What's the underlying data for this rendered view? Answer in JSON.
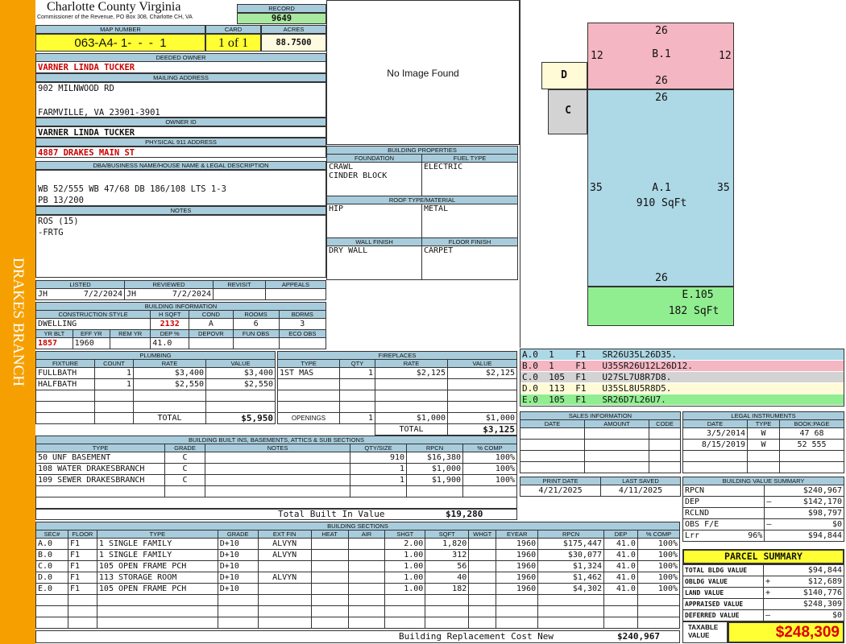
{
  "side_label": "DRAKES BRANCH",
  "header": {
    "county": "Charlotte County Virginia",
    "commissioner": "Commissioner of the Revenue, PO Box 308, Charlotte CH, VA",
    "record_label": "RECORD",
    "record": "9649",
    "map_label": "MAP NUMBER",
    "map_number": "063-A4- 1-  -  -  1",
    "card_label": "CARD",
    "card": "1 of 1",
    "acres_label": "ACRES",
    "acres": "88.7500"
  },
  "owner": {
    "deeded_label": "DEEDED OWNER",
    "deeded": "VARNER LINDA TUCKER",
    "mailing_label": "MAILING ADDRESS",
    "mail1": "902 MILNWOOD RD",
    "mail2": "FARMVILLE, VA 23901-3901",
    "owner_id_label": "OWNER ID",
    "owner_id": "VARNER LINDA TUCKER",
    "phys_label": "PHYSICAL 911 ADDRESS",
    "phys": "4887 DRAKES MAIN ST"
  },
  "legal": {
    "label": "DBA/BUSINESS NAME/HOUSE NAME & LEGAL DESCRIPTION",
    "line1": "WB 52/555 WB 47/68 DB 186/108 LTS 1-3",
    "line2": "PB 13/200"
  },
  "notes": {
    "label": "NOTES",
    "line1": "ROS (15)",
    "line2": "-FRTG"
  },
  "review": {
    "listed_label": "LISTED",
    "reviewed_label": "REVIEWED",
    "revisit_label": "REVISIT",
    "appeals_label": "APPEALS",
    "listed_by": "JH",
    "listed_date": "7/2/2024",
    "reviewed_by": "JH",
    "reviewed_date": "7/2/2024"
  },
  "bldg_info": {
    "label": "BUILDING INFORMATION",
    "cs_label": "CONSTRUCTION STYLE",
    "hsqft_label": "H SQFT",
    "cond_label": "COND",
    "rooms_label": "ROOMS",
    "bdrms_label": "BDRMS",
    "style": "DWELLING",
    "hsqft": "2132",
    "cond": "A",
    "rooms": "6",
    "bdrms": "3",
    "yrblt_label": "YR BLT",
    "effyr_label": "EFF YR",
    "remyr_label": "REM YR",
    "dep_label": "DEP %",
    "depovr_label": "DEPOVR",
    "funobs_label": "FUN OBS",
    "ecoobs_label": "ECO OBS",
    "yrblt": "1857",
    "effyr": "1960",
    "dep": "41.0"
  },
  "image": {
    "text": "No Image Found"
  },
  "bprops": {
    "label": "BUILDING PROPERTIES",
    "foundation_label": "FOUNDATION",
    "fuel_label": "FUEL TYPE",
    "foundation1": "CRAWL",
    "foundation2": "CINDER BLOCK",
    "fuel": "ELECTRIC",
    "roof_label": "ROOF TYPE/MATERIAL",
    "roof_type": "HIP",
    "roof_mat": "METAL",
    "wall_label": "WALL FINISH",
    "floor_label": "FLOOR FINISH",
    "wall": "DRY WALL",
    "floor": "CARPET"
  },
  "sketch": {
    "b_top": "26",
    "b_left": "12",
    "b_right": "12",
    "b_name": "B.1",
    "b_bottom": "26",
    "d_name": "D",
    "c_name": "C",
    "a_top": "26",
    "a_left": "35",
    "a_right": "35",
    "a_name": "A.1",
    "a_area": "910 SqFt",
    "a_bottom": "26",
    "e_name": "E.105",
    "e_area": "182 SqFt",
    "colors": {
      "a": "#add8e6",
      "b": "#f4b6c2",
      "c": "#d3d3d3",
      "d": "#fffbd6",
      "e": "#90ee90"
    }
  },
  "segments": [
    {
      "text": "A.0  1    F1   SR26U35L26D35.",
      "color": "#add8e6"
    },
    {
      "text": "B.0  1    F1   U35SR26U12L26D12.",
      "color": "#f4b6c2"
    },
    {
      "text": "C.0  105  F1   U27SL7U8R7D8.",
      "color": "#d3d3d3"
    },
    {
      "text": "D.0  113  F1   U35SL8U5R8D5.",
      "color": "#fffbd6"
    },
    {
      "text": "E.0  105  F1   SR26D7L26U7.",
      "color": "#90ee90"
    }
  ],
  "plumbing": {
    "label": "PLUMBING",
    "cols": [
      "FIXTURE",
      "COUNT",
      "RATE",
      "VALUE"
    ],
    "rows": [
      [
        "FULLBATH",
        "1",
        "$3,400",
        "$3,400"
      ],
      [
        "HALFBATH",
        "1",
        "$2,550",
        "$2,550"
      ]
    ],
    "total_label": "TOTAL",
    "total": "$5,950"
  },
  "fireplaces": {
    "label": "FIREPLACES",
    "cols": [
      "TYPE",
      "QTY",
      "RATE",
      "VALUE"
    ],
    "rows": [
      [
        "1ST MAS",
        "1",
        "$2,125",
        "$2,125"
      ]
    ],
    "openings_label": "OPENINGS",
    "openings_qty": "1",
    "openings_rate": "$1,000",
    "openings_value": "$1,000",
    "total_label": "TOTAL",
    "total": "$3,125"
  },
  "builtins": {
    "label": "BUILDING BUILT INS, BASEMENTS, ATTICS & SUB SECTIONS",
    "cols": [
      "TYPE",
      "GRADE",
      "NOTES",
      "QTY/SIZE",
      "RPCN",
      "% COMP"
    ],
    "rows": [
      [
        "50 UNF BASEMENT",
        "C",
        "",
        "910",
        "$16,380",
        "100%"
      ],
      [
        "108 WATER DRAKESBRANCH",
        "C",
        "",
        "1",
        "$1,000",
        "100%"
      ],
      [
        "109 SEWER DRAKESBRANCH",
        "C",
        "",
        "1",
        "$1,900",
        "100%"
      ]
    ],
    "total_label": "Total Built In Value",
    "total": "$19,280"
  },
  "sales": {
    "label": "SALES INFORMATION",
    "cols": [
      "DATE",
      "AMOUNT",
      "CODE"
    ]
  },
  "legal_instr": {
    "label": "LEGAL INSTRUMENTS",
    "cols": [
      "DATE",
      "TYPE",
      "BOOK:PAGE"
    ],
    "rows": [
      [
        "3/5/2014",
        "W",
        "47 68"
      ],
      [
        "8/15/2019",
        "W",
        "52 555"
      ]
    ]
  },
  "dates": {
    "print_label": "PRINT DATE",
    "print": "4/21/2025",
    "saved_label": "LAST SAVED",
    "saved": "4/11/2025"
  },
  "value_summary": {
    "label": "BUILDING VALUE SUMMARY",
    "rows": [
      [
        "RPCN",
        "",
        "$240,967"
      ],
      [
        "DEP",
        "–",
        "$142,170"
      ],
      [
        "RCLND",
        "",
        "$98,797"
      ],
      [
        "OBS F/E",
        "–",
        "$0"
      ],
      [
        "Lrr          96%",
        "",
        "$94,844"
      ]
    ]
  },
  "parcel": {
    "label": "PARCEL SUMMARY",
    "rows": [
      [
        "TOTAL BLDG VALUE",
        "",
        "$94,844"
      ],
      [
        "OBLDG VALUE",
        "+",
        "$12,689"
      ],
      [
        "LAND VALUE",
        "+",
        "$140,776"
      ],
      [
        "APPRAISED VALUE",
        "",
        "$248,309"
      ],
      [
        "DEFERRED VALUE",
        "–",
        "$0"
      ]
    ],
    "taxable_label1": "TAXABLE",
    "taxable_label2": "VALUE",
    "taxable": "$248,309"
  },
  "sections": {
    "label": "BUILDING SECTIONS",
    "cols": [
      "SEC#",
      "FLOOR",
      "TYPE",
      "GRADE",
      "EXT FIN",
      "HEAT",
      "AIR",
      "SHGT",
      "SQFT",
      "WHGT",
      "EYEAR",
      "RPCN",
      "DEP",
      "% COMP"
    ],
    "rows": [
      [
        "A.0",
        "F1",
        "1 SINGLE FAMILY",
        "D+10",
        "ALVYN",
        "",
        "",
        "2.00",
        "1,820",
        "",
        "1960",
        "$175,447",
        "41.0",
        "100%"
      ],
      [
        "B.0",
        "F1",
        "1 SINGLE FAMILY",
        "D+10",
        "ALVYN",
        "",
        "",
        "1.00",
        "312",
        "",
        "1960",
        "$30,077",
        "41.0",
        "100%"
      ],
      [
        "C.0",
        "F1",
        "105 OPEN FRAME PCH",
        "D+10",
        "",
        "",
        "",
        "1.00",
        "56",
        "",
        "1960",
        "$1,324",
        "41.0",
        "100%"
      ],
      [
        "D.0",
        "F1",
        "113 STORAGE ROOM",
        "D+10",
        "ALVYN",
        "",
        "",
        "1.00",
        "40",
        "",
        "1960",
        "$1,462",
        "41.0",
        "100%"
      ],
      [
        "E.0",
        "F1",
        "105 OPEN FRAME PCH",
        "D+10",
        "",
        "",
        "",
        "1.00",
        "182",
        "",
        "1960",
        "$4,302",
        "41.0",
        "100%"
      ]
    ],
    "total_label": "Building Replacement Cost New",
    "total": "$240,967"
  }
}
